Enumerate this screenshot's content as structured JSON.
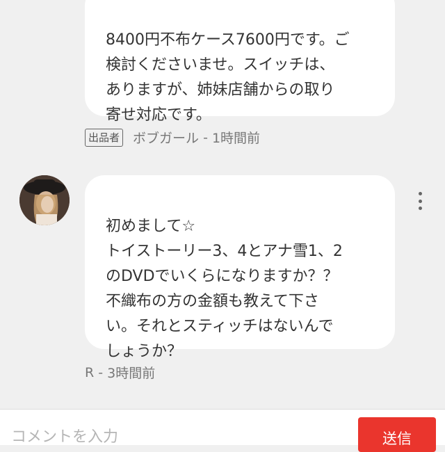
{
  "comments": [
    {
      "text": "8400円不布ケース7600円です。ご\n検討くださいませ。スイッチは、\nありますが、姉妹店舗からの取り\n寄せ対応です。",
      "seller_badge": "出品者",
      "author": "ボブガール",
      "separator": " - ",
      "time": "1時間前"
    },
    {
      "text": "初めまして☆\nトイストーリー3、4とアナ雪1、2\nのDVDでいくらになりますか？？\n不織布の方の金額も教えて下さ\nい。それとスティッチはないんで\nしょうか？",
      "author": "R",
      "separator": " - ",
      "time": "3時間前"
    }
  ],
  "composer": {
    "placeholder": "コメントを入力",
    "send_label": "送信"
  },
  "colors": {
    "background": "#f0f0f0",
    "bubble": "#ffffff",
    "send_button": "#ea352d",
    "meta_text": "#777777"
  },
  "icons": {
    "more_options": "kebab-vertical-icon"
  }
}
